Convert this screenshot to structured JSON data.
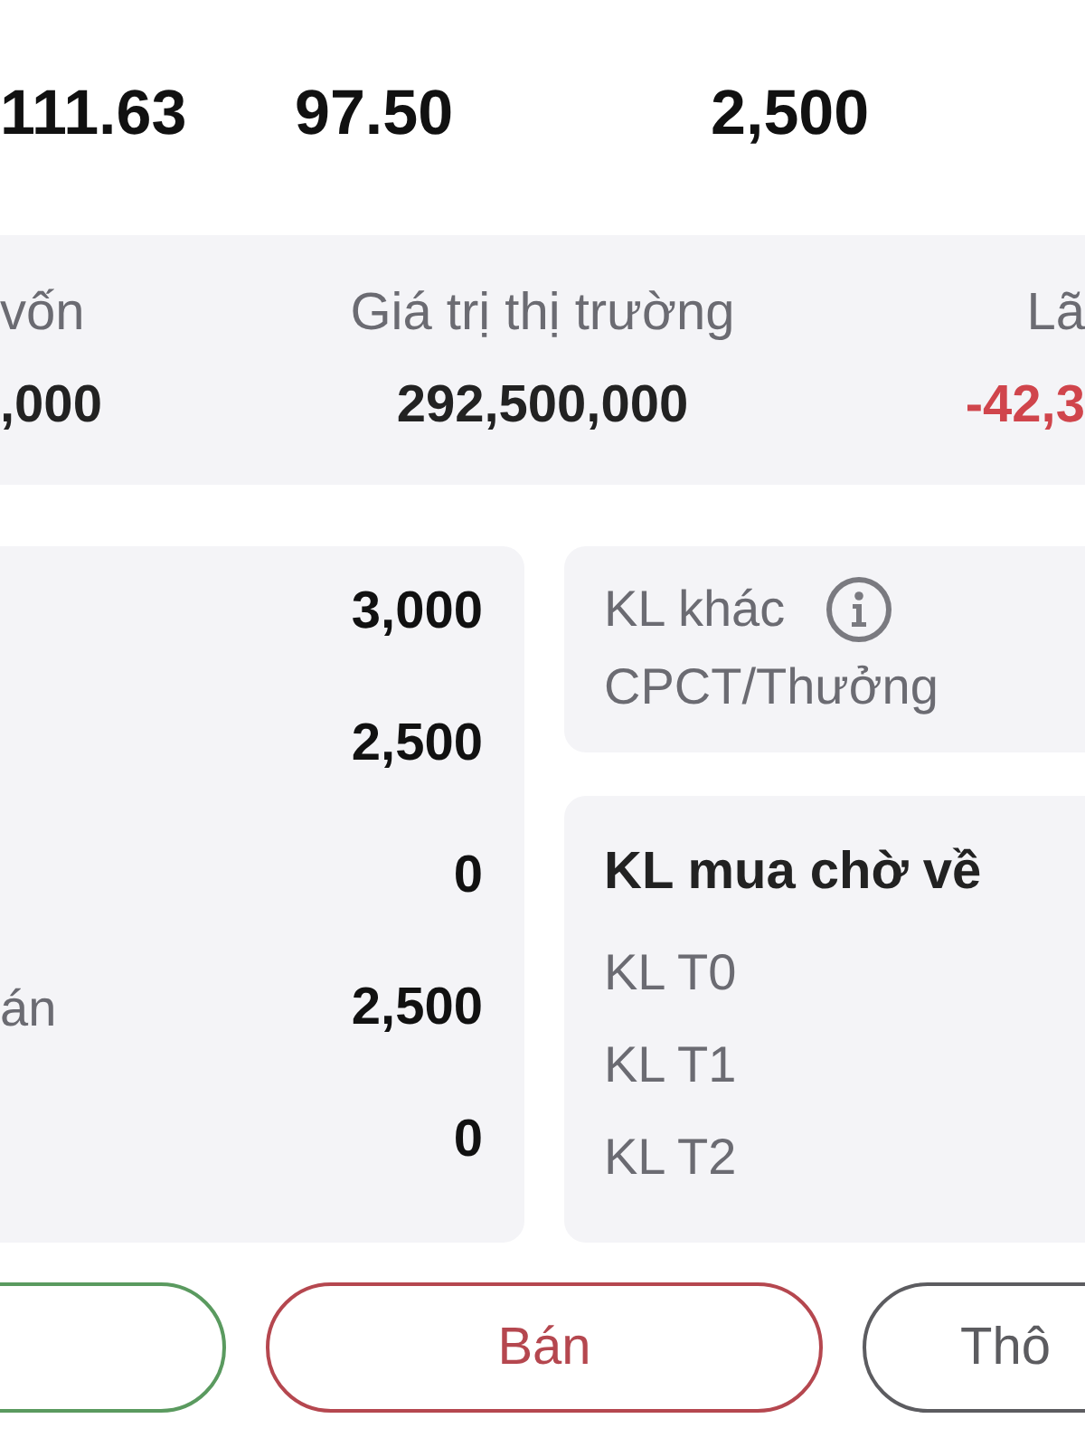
{
  "summary": {
    "values": [
      "111.63",
      "97.50",
      "2,500"
    ]
  },
  "overview": {
    "items": [
      {
        "label": "vốn",
        "value": ",000",
        "negative": false
      },
      {
        "label": "Giá trị thị trường",
        "value": "292,500,000",
        "negative": false
      },
      {
        "label": "Lã",
        "value": "-42,3",
        "negative": true
      }
    ]
  },
  "quantities": {
    "rows": [
      {
        "value": "3,000"
      },
      {
        "value": "2,500"
      },
      {
        "value": "0"
      },
      {
        "label": "án",
        "value": "2,500"
      },
      {
        "value": "0"
      }
    ]
  },
  "other_quantity": {
    "title": "KL khác",
    "subtitle": "CPCT/Thưởng"
  },
  "pending_buy": {
    "title": "KL mua chờ về",
    "rows": [
      "KL T0",
      "KL T1",
      "KL T2"
    ]
  },
  "actions": [
    {
      "kind": "buy"
    },
    {
      "kind": "sell",
      "label": "Bán"
    },
    {
      "kind": "info",
      "label": "Thô"
    }
  ]
}
